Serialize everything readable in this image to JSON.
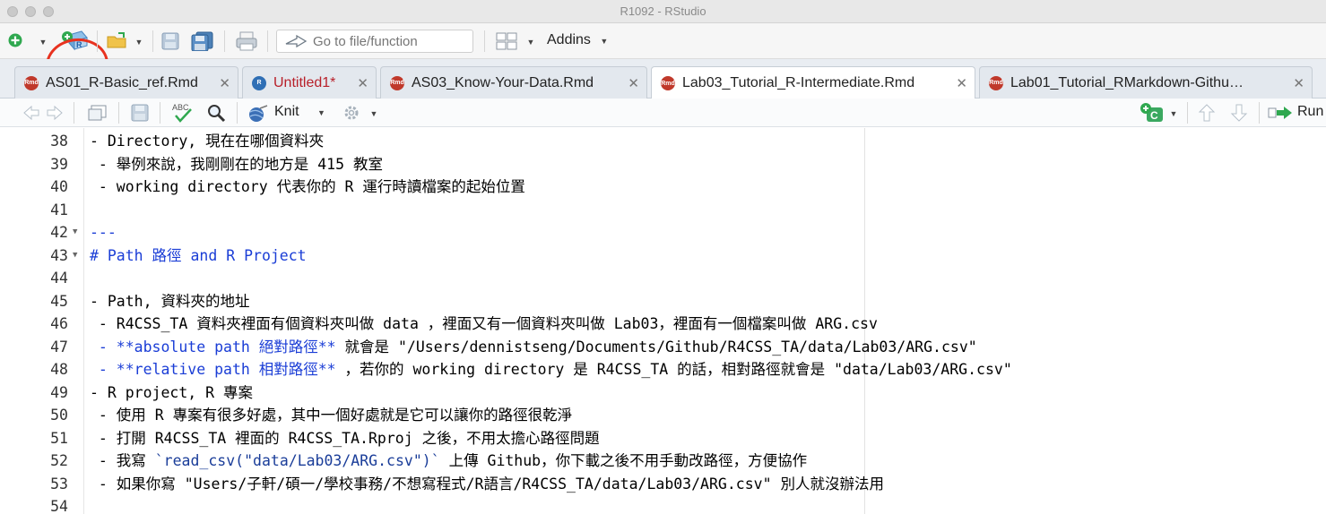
{
  "window": {
    "title": "R1092 - RStudio"
  },
  "toolbar": {
    "goto_placeholder": "Go to file/function",
    "addins_label": "Addins"
  },
  "tabs": [
    {
      "label": "AS01_R-Basic_ref.Rmd",
      "type": "rmd",
      "active": false,
      "unsaved": false
    },
    {
      "label": "Untitled1*",
      "type": "r",
      "active": false,
      "unsaved": true
    },
    {
      "label": "AS03_Know-Your-Data.Rmd",
      "type": "rmd",
      "active": false,
      "unsaved": false
    },
    {
      "label": "Lab03_Tutorial_R-Intermediate.Rmd",
      "type": "rmd",
      "active": true,
      "unsaved": false
    },
    {
      "label": "Lab01_Tutorial_RMarkdown-Githu…",
      "type": "rmd",
      "active": false,
      "unsaved": false
    }
  ],
  "editor_toolbar": {
    "knit_label": "Knit",
    "run_label": "Run"
  },
  "editor": {
    "lines": [
      {
        "n": "38",
        "text": "- Directory, 現在在哪個資料夾"
      },
      {
        "n": "39",
        "text": " - 舉例來說，我剛剛在的地方是 415 教室"
      },
      {
        "n": "40",
        "text": " - working directory 代表你的 R 運行時讀檔案的起始位置"
      },
      {
        "n": "41",
        "text": ""
      },
      {
        "n": "42",
        "text": "---"
      },
      {
        "n": "43",
        "text": "# Path 路徑 and R Project"
      },
      {
        "n": "44",
        "text": ""
      },
      {
        "n": "45",
        "text": "- Path, 資料夾的地址"
      },
      {
        "n": "46",
        "text": " - R4CSS_TA 資料夾裡面有個資料夾叫做 data ，裡面又有一個資料夾叫做 Lab03，裡面有一個檔案叫做 ARG.csv"
      },
      {
        "n": "47",
        "bold": " - **absolute path 絕對路徑**",
        "rest": " 就會是 \"/Users/dennistseng/Documents/Github/R4CSS_TA/data/Lab03/ARG.csv\""
      },
      {
        "n": "48",
        "bold": " - **relative path 相對路徑**",
        "rest": " ，若你的 working directory 是 R4CSS_TA 的話，相對路徑就會是 \"data/Lab03/ARG.csv\""
      },
      {
        "n": "49",
        "text": "- R project, R 專案"
      },
      {
        "n": "50",
        "text": " - 使用 R 專案有很多好處，其中一個好處就是它可以讓你的路徑很乾淨"
      },
      {
        "n": "51",
        "text": " - 打開 R4CSS_TA 裡面的 R4CSS_TA.Rproj 之後，不用太擔心路徑問題"
      },
      {
        "n": "52",
        "pre": " - 我寫 ",
        "code": "`read_csv(\"data/Lab03/ARG.csv\")`",
        "rest": " 上傳 Github，你下載之後不用手動改路徑，方便協作"
      },
      {
        "n": "53",
        "text": " - 如果你寫 \"Users/子軒/碩一/學校事務/不想寫程式/R語言/R4CSS_TA/data/Lab03/ARG.csv\" 別人就沒辦法用"
      },
      {
        "n": "54",
        "text": ""
      }
    ]
  }
}
